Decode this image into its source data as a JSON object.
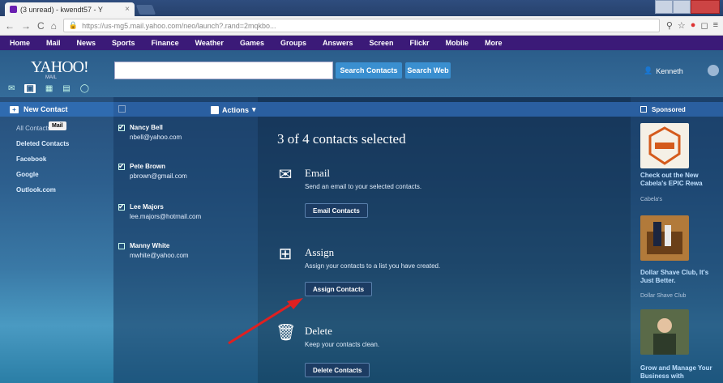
{
  "browser": {
    "tab_title": "(3 unread) - kwendt57 - Y",
    "url": "https://us-mg5.mail.yahoo.com/neo/launch?.rand=2mqkbo..."
  },
  "yahoo_nav": [
    "Home",
    "Mail",
    "News",
    "Sports",
    "Finance",
    "Weather",
    "Games",
    "Groups",
    "Answers",
    "Screen",
    "Flickr",
    "Mobile",
    "More"
  ],
  "header": {
    "logo": "YAHOO!",
    "logo_sub": "MAIL",
    "search_placeholder": "",
    "search_contacts_label": "Search Contacts",
    "search_web_label": "Search Web",
    "user_name": "Kenneth"
  },
  "sidebar": {
    "new_contact_label": "New Contact",
    "items": [
      {
        "label": "All Contacts",
        "tooltip": "Mail"
      },
      {
        "label": "Deleted Contacts"
      },
      {
        "label": "Facebook"
      },
      {
        "label": "Google"
      },
      {
        "label": "Outlook.com"
      }
    ]
  },
  "list": {
    "action_label": "Actions",
    "contacts": [
      {
        "name": "Nancy Bell",
        "email": "nbell@yahoo.com",
        "checked": true
      },
      {
        "name": "Pete Brown",
        "email": "pbrown@gmail.com",
        "checked": true
      },
      {
        "name": "Lee Majors",
        "email": "lee.majors@hotmail.com",
        "checked": true
      },
      {
        "name": "Manny White",
        "email": "mwhite@yahoo.com",
        "checked": false
      }
    ]
  },
  "main": {
    "selection_title": "3 of 4 contacts selected",
    "email": {
      "title": "Email",
      "desc": "Send an email to your selected contacts.",
      "button": "Email Contacts"
    },
    "assign": {
      "title": "Assign",
      "desc": "Assign your contacts to a list you have created.",
      "button": "Assign Contacts"
    },
    "delete": {
      "title": "Delete",
      "desc": "Keep your contacts clean.",
      "button": "Delete Contacts"
    }
  },
  "sponsored": {
    "header": "Sponsored",
    "ads": [
      {
        "title": "Check out the New Cabela's EPIC Rewa",
        "source": "Cabela's"
      },
      {
        "title": "Dollar Shave Club, It's Just Better.",
        "source": "Dollar Shave Club"
      },
      {
        "title": "Grow and Manage Your Business with",
        "source": ""
      }
    ]
  },
  "colors": {
    "yahoo_purple": "#3b1a78",
    "accent_blue": "#2a5fa0",
    "arrow_red": "#e02020"
  }
}
